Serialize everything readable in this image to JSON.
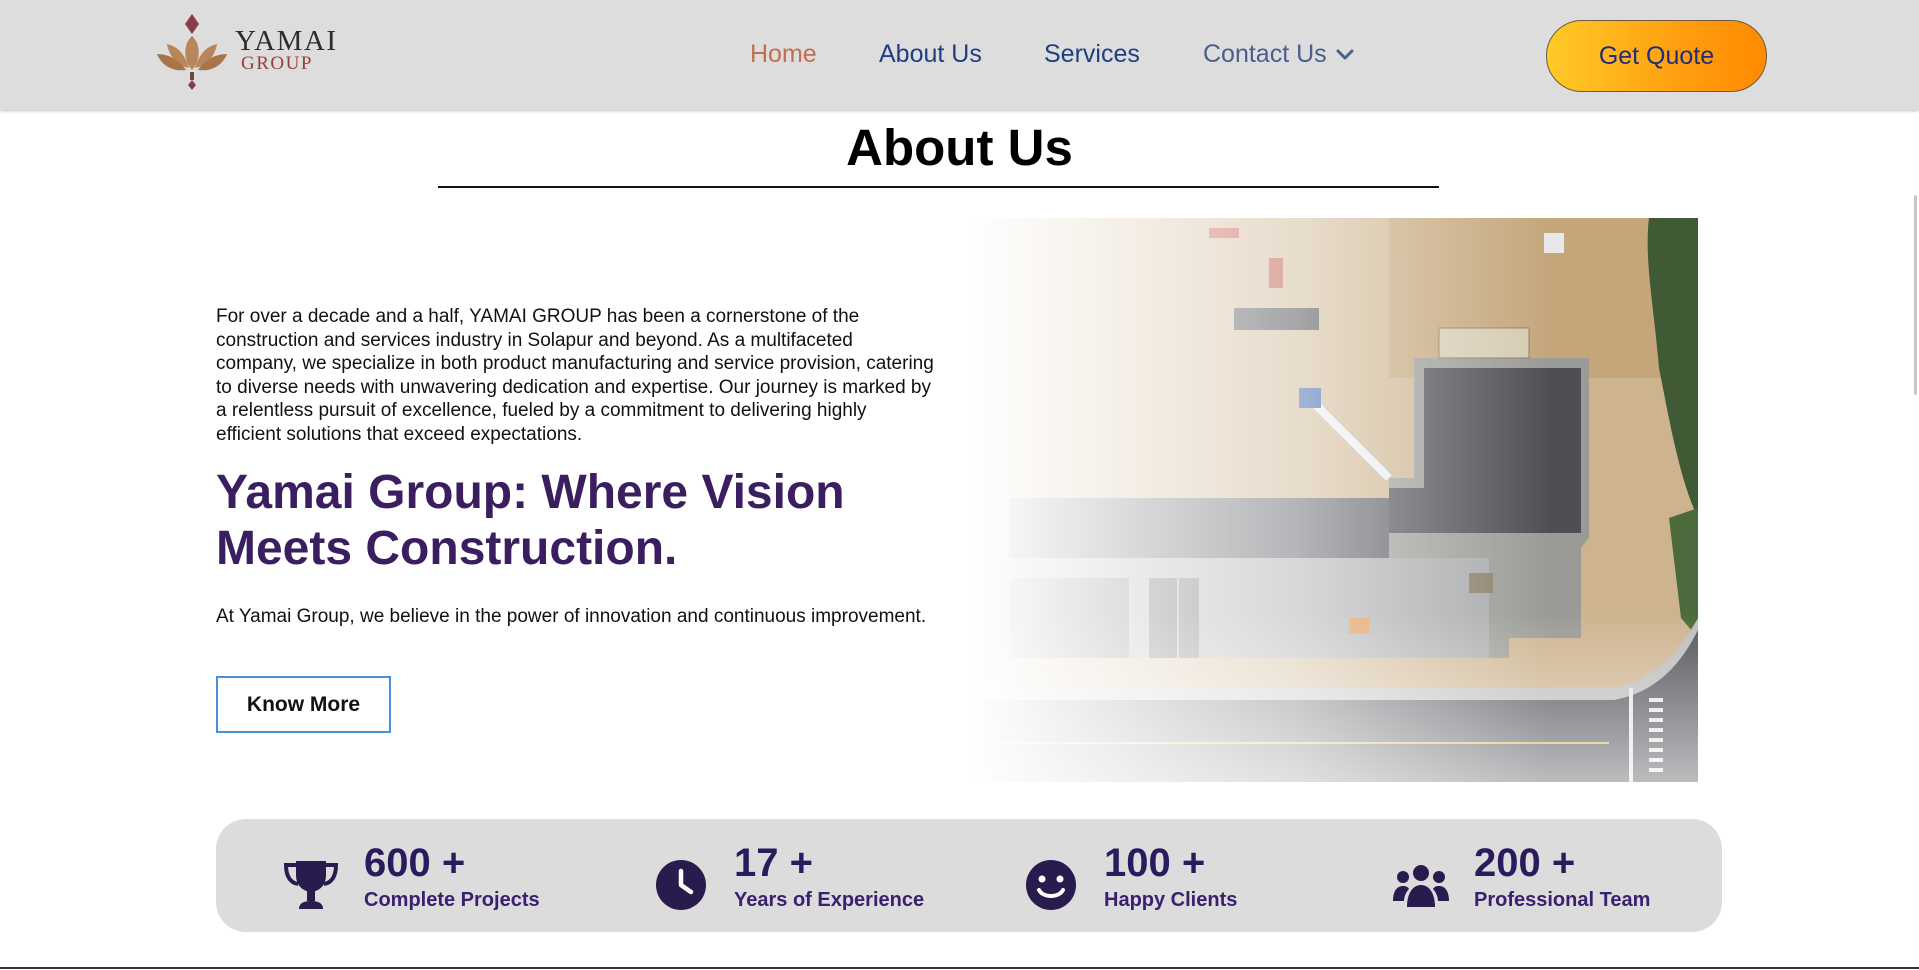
{
  "brand": {
    "name": "YAMAI",
    "sub": "GROUP"
  },
  "nav": {
    "home": "Home",
    "about": "About Us",
    "services": "Services",
    "contact": "Contact Us"
  },
  "header": {
    "quote_label": "Get Quote"
  },
  "about": {
    "title": "About Us",
    "paragraph": "For over a decade and a half, YAMAI GROUP has been a cornerstone of the construction and services industry in Solapur and beyond. As a multifaceted company, we specialize in both product manufacturing and service provision, catering to diverse needs with unwavering dedication and expertise. Our journey is marked by a relentless pursuit of excellence, fueled by a commitment to delivering highly efficient solutions that exceed expectations.",
    "tagline": "Yamai Group: Where Vision Meets Construction.",
    "sub": "At Yamai Group, we believe in the power of innovation and continuous improvement.",
    "button": "Know More"
  },
  "stats": [
    {
      "number": "600 +",
      "label": "Complete Projects",
      "icon": "trophy-icon"
    },
    {
      "number": "17 +",
      "label": "Years of Experience",
      "icon": "clock-icon"
    },
    {
      "number": "100 +",
      "label": "Happy Clients",
      "icon": "smiley-icon"
    },
    {
      "number": "200 +",
      "label": "Professional Team",
      "icon": "team-icon"
    }
  ],
  "colors": {
    "header_bg": "#dddddd",
    "nav_active": "#c0704f",
    "nav_link": "#1e3f82",
    "tagline": "#3a1e5f",
    "stat_number": "#2a1b5c",
    "quote_gradient_start": "#ffca28",
    "quote_gradient_end": "#ff8a00"
  }
}
